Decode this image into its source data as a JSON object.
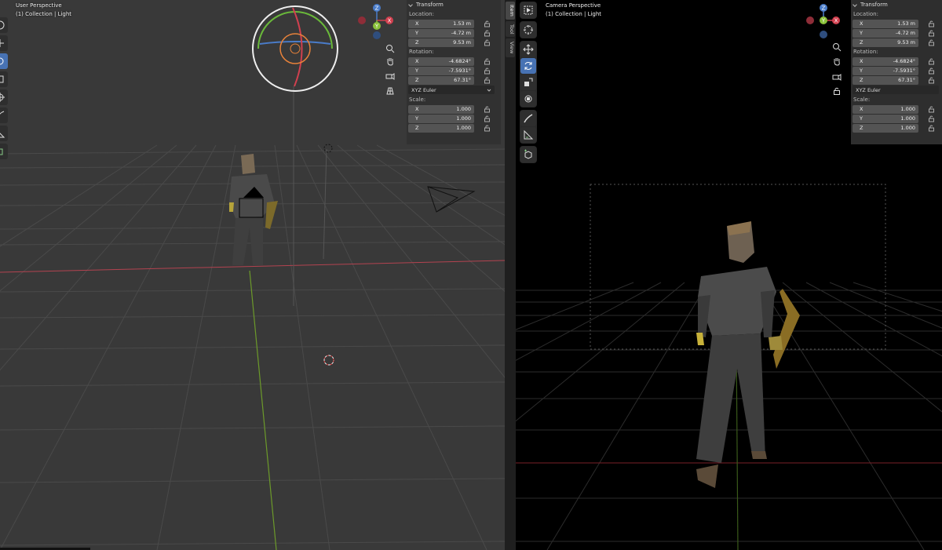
{
  "left_viewport": {
    "title": "User Perspective",
    "subtitle": "(1) Collection | Light"
  },
  "right_viewport": {
    "title": "Camera Perspective",
    "subtitle": "(1) Collection | Light"
  },
  "side_tabs": [
    "Item",
    "Tool",
    "View"
  ],
  "gizmo_axes": {
    "x": "X",
    "y": "Y",
    "z": "Z"
  },
  "transform_panel": {
    "header": "Transform",
    "location_label": "Location:",
    "location": [
      {
        "axis": "X",
        "value": "1.53 m"
      },
      {
        "axis": "Y",
        "value": "-4.72 m"
      },
      {
        "axis": "Z",
        "value": "9.53 m"
      }
    ],
    "rotation_label": "Rotation:",
    "rotation": [
      {
        "axis": "X",
        "value": "-4.6824°"
      },
      {
        "axis": "Y",
        "value": "-7.5931°"
      },
      {
        "axis": "Z",
        "value": "67.31°"
      }
    ],
    "rotation_mode": "XYZ Euler",
    "scale_label": "Scale:",
    "scale": [
      {
        "axis": "X",
        "value": "1.000"
      },
      {
        "axis": "Y",
        "value": "1.000"
      },
      {
        "axis": "Z",
        "value": "1.000"
      }
    ]
  },
  "colors": {
    "x_axis": "#d2404f",
    "y_axis": "#8bc23a",
    "z_axis": "#4a7cc9",
    "active_tool": "#4772b3",
    "viewport_left_bg": "#393939",
    "viewport_right_bg": "#000000"
  }
}
